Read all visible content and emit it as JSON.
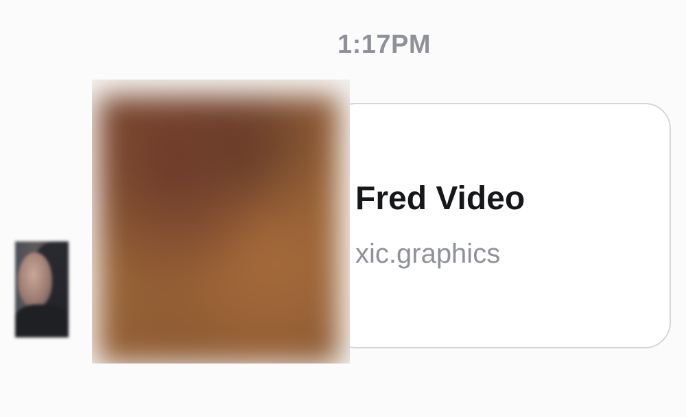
{
  "message": {
    "timestamp": "1:17PM",
    "link_preview": {
      "title": "Fred Video",
      "domain": "xic.graphics"
    }
  },
  "colors": {
    "timestamp": "#8e9197",
    "title": "#16171a",
    "domain": "#8e9197",
    "card_border": "#d5d6da"
  },
  "icons": {
    "avatar": "sender-avatar",
    "thumbnail": "link-thumbnail-image"
  }
}
